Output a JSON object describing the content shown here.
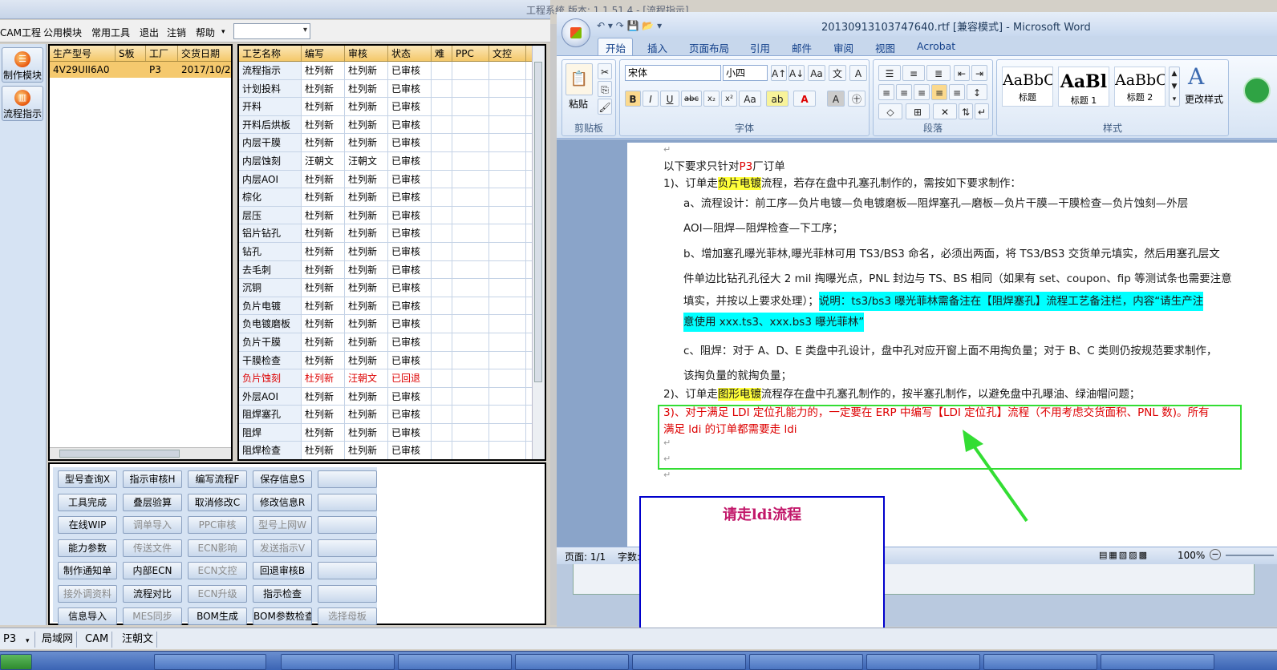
{
  "app": {
    "title": "工程系统  版本: 1.1.51.4 - [流程指示]",
    "menu": [
      "CAM工程",
      "公用模块",
      "常用工具",
      "退出",
      "注销",
      "帮助"
    ],
    "menu_combo_value": "",
    "nav": [
      {
        "label": "制作模块",
        "icon": "production-module-icon"
      },
      {
        "label": "流程指示",
        "icon": "flow-instruction-icon"
      }
    ]
  },
  "orders": {
    "columns": [
      "生产型号",
      "S板",
      "工厂",
      "交货日期"
    ],
    "rows": [
      {
        "model": "4V29UII6A0",
        "s_board": "",
        "factory": "P3",
        "date": "2017/10/2("
      }
    ]
  },
  "process": {
    "columns": [
      "工艺名称",
      "编写",
      "审核",
      "状态",
      "难",
      "PPC",
      "文控"
    ],
    "rows": [
      {
        "name": "流程指示",
        "writer": "杜列新",
        "reviewer": "杜列新",
        "status": "已审核"
      },
      {
        "name": "计划投料",
        "writer": "杜列新",
        "reviewer": "杜列新",
        "status": "已审核"
      },
      {
        "name": "开料",
        "writer": "杜列新",
        "reviewer": "杜列新",
        "status": "已审核"
      },
      {
        "name": "开料后烘板",
        "writer": "杜列新",
        "reviewer": "杜列新",
        "status": "已审核"
      },
      {
        "name": "内层干膜",
        "writer": "杜列新",
        "reviewer": "杜列新",
        "status": "已审核"
      },
      {
        "name": "内层蚀刻",
        "writer": "汪朝文",
        "reviewer": "汪朝文",
        "status": "已审核"
      },
      {
        "name": "内层AOI",
        "writer": "杜列新",
        "reviewer": "杜列新",
        "status": "已审核"
      },
      {
        "name": "棕化",
        "writer": "杜列新",
        "reviewer": "杜列新",
        "status": "已审核"
      },
      {
        "name": "层压",
        "writer": "杜列新",
        "reviewer": "杜列新",
        "status": "已审核"
      },
      {
        "name": "铝片钻孔",
        "writer": "杜列新",
        "reviewer": "杜列新",
        "status": "已审核"
      },
      {
        "name": "钻孔",
        "writer": "杜列新",
        "reviewer": "杜列新",
        "status": "已审核"
      },
      {
        "name": "去毛刺",
        "writer": "杜列新",
        "reviewer": "杜列新",
        "status": "已审核"
      },
      {
        "name": "沉铜",
        "writer": "杜列新",
        "reviewer": "杜列新",
        "status": "已审核"
      },
      {
        "name": "负片电镀",
        "writer": "杜列新",
        "reviewer": "杜列新",
        "status": "已审核"
      },
      {
        "name": "负电镀磨板",
        "writer": "杜列新",
        "reviewer": "杜列新",
        "status": "已审核"
      },
      {
        "name": "负片干膜",
        "writer": "杜列新",
        "reviewer": "杜列新",
        "status": "已审核"
      },
      {
        "name": "干膜检查",
        "writer": "杜列新",
        "reviewer": "杜列新",
        "status": "已审核"
      },
      {
        "name": "负片蚀刻",
        "writer": "杜列新",
        "reviewer": "汪朝文",
        "status": "已回退",
        "rejected": true
      },
      {
        "name": "外层AOI",
        "writer": "杜列新",
        "reviewer": "杜列新",
        "status": "已审核"
      },
      {
        "name": "阻焊塞孔",
        "writer": "杜列新",
        "reviewer": "杜列新",
        "status": "已审核"
      },
      {
        "name": "阻焊",
        "writer": "杜列新",
        "reviewer": "杜列新",
        "status": "已审核"
      },
      {
        "name": "阻焊检查",
        "writer": "杜列新",
        "reviewer": "杜列新",
        "status": "已审核"
      }
    ]
  },
  "buttons": [
    [
      {
        "label": "型号查询X",
        "enabled": true
      },
      {
        "label": "指示审核H",
        "enabled": true
      },
      {
        "label": "编写流程F",
        "enabled": true
      },
      {
        "label": "保存信息S",
        "enabled": true
      },
      {
        "label": "",
        "enabled": true
      }
    ],
    [
      {
        "label": "工具完成",
        "enabled": true
      },
      {
        "label": "叠层验算",
        "enabled": true
      },
      {
        "label": "取消修改C",
        "enabled": true
      },
      {
        "label": "修改信息R",
        "enabled": true
      },
      {
        "label": "",
        "enabled": true
      }
    ],
    [
      {
        "label": "在线WIP",
        "enabled": true
      },
      {
        "label": "调单导入",
        "enabled": false
      },
      {
        "label": "PPC审核",
        "enabled": false
      },
      {
        "label": "型号上网W",
        "enabled": false
      },
      {
        "label": "",
        "enabled": true
      }
    ],
    [
      {
        "label": "能力参数",
        "enabled": true
      },
      {
        "label": "传送文件",
        "enabled": false
      },
      {
        "label": "ECN影响",
        "enabled": false
      },
      {
        "label": "发送指示V",
        "enabled": false
      },
      {
        "label": "",
        "enabled": true
      }
    ],
    [
      {
        "label": "制作通知单",
        "enabled": true
      },
      {
        "label": "内部ECN",
        "enabled": true
      },
      {
        "label": "ECN文控",
        "enabled": false
      },
      {
        "label": "回退审核B",
        "enabled": true
      },
      {
        "label": "",
        "enabled": true
      }
    ],
    [
      {
        "label": "接外调资料",
        "enabled": false
      },
      {
        "label": "流程对比",
        "enabled": true
      },
      {
        "label": "ECN升级",
        "enabled": false
      },
      {
        "label": "指示检查",
        "enabled": true
      },
      {
        "label": "",
        "enabled": true
      }
    ],
    [
      {
        "label": "信息导入",
        "enabled": true
      },
      {
        "label": "MES同步",
        "enabled": false
      },
      {
        "label": "BOM生成",
        "enabled": true
      },
      {
        "label": "BOM参数检查",
        "enabled": true
      },
      {
        "label": "选择母板",
        "enabled": false
      }
    ]
  ],
  "statusbar": {
    "factory": "P3",
    "network": "局域网",
    "module": "CAM",
    "user": "汪朝文"
  },
  "word": {
    "title": "20130913103747640.rtf [兼容模式] - Microsoft Word",
    "tabs": [
      "开始",
      "插入",
      "页面布局",
      "引用",
      "邮件",
      "审阅",
      "视图",
      "Acrobat"
    ],
    "font_name": "宋体",
    "font_size": "小四",
    "groups": {
      "clipboard": "剪贴板",
      "font": "字体",
      "paragraph": "段落",
      "styles": "样式"
    },
    "paste_label": "粘贴",
    "change_styles": "更改样式",
    "styles": [
      {
        "sample": "AaBbC",
        "name": "标题"
      },
      {
        "sample": "AaBl",
        "name": "标题 1"
      },
      {
        "sample": "AaBbC",
        "name": "标题 2"
      }
    ],
    "doc": {
      "l0": "以下要求只针对",
      "l0_red": "P3",
      "l0_tail": "厂订单",
      "l1_a": "1)、订单走",
      "l1_hl": "负片电镀",
      "l1_b": "流程，若存在盘中孔塞孔制作的，需按如下要求制作：",
      "l2": "a、流程设计：前工序—负片电镀—负电镀磨板—阻焊塞孔—磨板—负片干膜—干膜检查—负片蚀刻—外层",
      "l3": "AOI—阻焊—阻焊检查—下工序；",
      "l4": "b、增加塞孔曝光菲林,曝光菲林可用 TS3/BS3 命名，必须出两面，将 TS3/BS3 交货单元填实，然后用塞孔层文",
      "l5": "件单边比钻孔孔径大 2 mil 掏曝光点，PNL 封边与 TS、BS 相同（如果有 set、coupon、fip 等测试条也需要注意",
      "l6_a": "填实，并按以上要求处理）；",
      "l6_hl": "说明：ts3/bs3 曝光菲林需备注在【阻焊塞孔】流程工艺备注栏，内容“请生产注",
      "l7_hl": "意使用 xxx.ts3、xxx.bs3 曝光菲林”",
      "l8": "c、阻焊：对于 A、D、E 类盘中孔设计，盘中孔对应开窗上面不用掏负量；对于 B、C 类则仍按规范要求制作，",
      "l9": "该掏负量的就掏负量；",
      "l10_a": "2)、订单走",
      "l10_hl": "图形电镀",
      "l10_b": "流程存在盘中孔塞孔制作的，按半塞孔制作，以避免盘中孔曝油、绿油帽问题；",
      "l11": "3)、对于满足 LDI 定位孔能力的，一定要在 ERP 中编写【LDI 定位孔】流程（不用考虑交货面积、PNL 数)。所有",
      "l12": "满足 ldi 的订单都需要走 ldi"
    },
    "status_page": "页面: 1/1",
    "status_words": "字数:",
    "zoom": "100%"
  },
  "note": {
    "text": "请走ldi流程"
  },
  "colors": {
    "highlight_yellow": "#ffff3a",
    "highlight_cyan": "#00ffff",
    "annotation_green": "#33dd33",
    "note_border": "#0000cc",
    "note_text": "#c2186a",
    "rejected": "#dd0000"
  }
}
